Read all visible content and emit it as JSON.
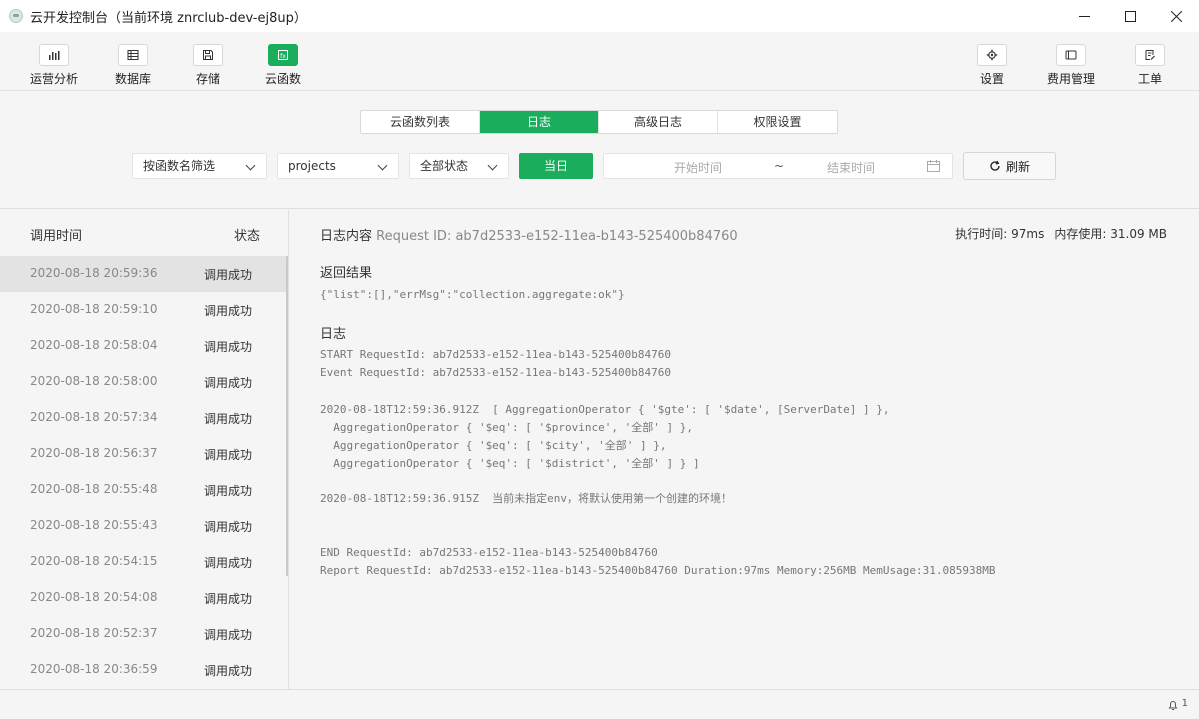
{
  "window": {
    "title": "云开发控制台（当前环境 znrclub-dev-ej8up）",
    "minimize": "—",
    "maximize": "☐",
    "close": "✕"
  },
  "toolbar": {
    "left": [
      {
        "label": "运营分析",
        "icon": "bar-chart-icon"
      },
      {
        "label": "数据库",
        "icon": "database-icon"
      },
      {
        "label": "存储",
        "icon": "save-icon"
      },
      {
        "label": "云函数",
        "icon": "function-icon",
        "active": true
      }
    ],
    "right": [
      {
        "label": "设置",
        "icon": "gear-icon"
      },
      {
        "label": "费用管理",
        "icon": "billing-icon"
      },
      {
        "label": "工单",
        "icon": "ticket-icon"
      }
    ]
  },
  "tabs": [
    {
      "label": "云函数列表"
    },
    {
      "label": "日志",
      "active": true
    },
    {
      "label": "高级日志"
    },
    {
      "label": "权限设置"
    }
  ],
  "filters": {
    "function_filter": "按函数名筛选",
    "function_selected": "projects",
    "status_selected": "全部状态",
    "today": "当日",
    "start_placeholder": "开始时间",
    "range_separator": "~",
    "end_placeholder": "结束时间",
    "refresh": "刷新"
  },
  "log_list": {
    "col_time": "调用时间",
    "col_status": "状态",
    "rows": [
      {
        "time": "2020-08-18 20:59:36",
        "status": "调用成功",
        "selected": true
      },
      {
        "time": "2020-08-18 20:59:10",
        "status": "调用成功"
      },
      {
        "time": "2020-08-18 20:58:04",
        "status": "调用成功"
      },
      {
        "time": "2020-08-18 20:58:00",
        "status": "调用成功"
      },
      {
        "time": "2020-08-18 20:57:34",
        "status": "调用成功"
      },
      {
        "time": "2020-08-18 20:56:37",
        "status": "调用成功"
      },
      {
        "time": "2020-08-18 20:55:48",
        "status": "调用成功"
      },
      {
        "time": "2020-08-18 20:55:43",
        "status": "调用成功"
      },
      {
        "time": "2020-08-18 20:54:15",
        "status": "调用成功"
      },
      {
        "time": "2020-08-18 20:54:08",
        "status": "调用成功"
      },
      {
        "time": "2020-08-18 20:52:37",
        "status": "调用成功"
      },
      {
        "time": "2020-08-18 20:36:59",
        "status": "调用成功"
      }
    ]
  },
  "detail": {
    "header_label": "日志内容",
    "request_id": "Request ID: ab7d2533-e152-11ea-b143-525400b84760",
    "exec_time": "执行时间: 97ms",
    "memory": "内存使用: 31.09 MB",
    "result_title": "返回结果",
    "result_body": "{\"list\":[],\"errMsg\":\"collection.aggregate:ok\"}",
    "log_title": "日志",
    "log_start": "START RequestId: ab7d2533-e152-11ea-b143-525400b84760\nEvent RequestId: ab7d2533-e152-11ea-b143-525400b84760",
    "log_body": "2020-08-18T12:59:36.912Z  [ AggregationOperator { '$gte': [ '$date', [ServerDate] ] },\n  AggregationOperator { '$eq': [ '$province', '全部' ] },\n  AggregationOperator { '$eq': [ '$city', '全部' ] },\n  AggregationOperator { '$eq': [ '$district', '全部' ] } ]",
    "log_warning": "2020-08-18T12:59:36.915Z  当前未指定env，将默认使用第一个创建的环境！",
    "log_end": "END RequestId: ab7d2533-e152-11ea-b143-525400b84760\nReport RequestId: ab7d2533-e152-11ea-b143-525400b84760 Duration:97ms Memory:256MB MemUsage:31.085938MB"
  },
  "statusbar": {
    "notification_count": "1"
  },
  "colors": {
    "accent": "#1aad5c",
    "background": "#f5f5f5"
  }
}
